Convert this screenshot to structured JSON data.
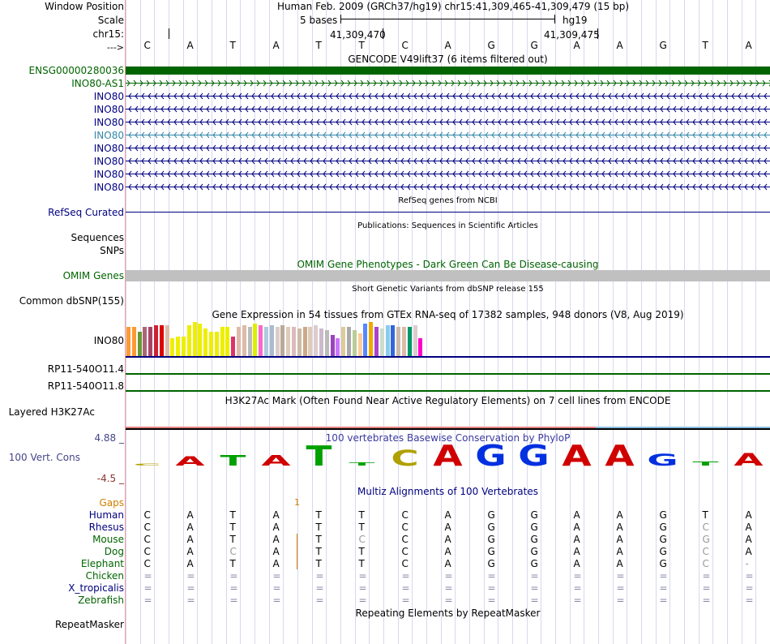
{
  "left_labels": {
    "window_position": "Window Position",
    "scale": "Scale",
    "chrom": "chr15:",
    "arrow": "--->",
    "gene_ensg": "ENSG00000280036",
    "gene_ino80as1": "INO80-AS1",
    "ino80_rows": [
      "INO80",
      "INO80",
      "INO80",
      "INO80",
      "INO80",
      "INO80",
      "INO80",
      "INO80"
    ],
    "refseq": "RefSeq Curated",
    "sequences": "Sequences",
    "snps": "SNPs",
    "omim": "OMIM Genes",
    "dbsnp": "Common dbSNP(155)",
    "gtex_gene": "INO80",
    "rp11_4": "RP11-540O11.4",
    "rp11_8": "RP11-540O11.8",
    "layered": "Layered H3K27Ac",
    "cons_max": "4.88 _",
    "cons_label": "100 Vert. Cons",
    "cons_min": "-4.5 _",
    "gaps": "Gaps",
    "species": [
      "Human",
      "Rhesus",
      "Mouse",
      "Dog",
      "Elephant",
      "Chicken",
      "X_tropicalis",
      "Zebrafish"
    ],
    "repeatmasker": "RepeatMasker"
  },
  "header": {
    "position": "Human Feb. 2009 (GRCh37/hg19)   chr15:41,309,465-41,309,479 (15 bp)",
    "scale_text": "5 bases",
    "assembly": "hg19",
    "coord1": "41,309,470",
    "coord2": "41,309,475"
  },
  "bases": [
    "C",
    "A",
    "T",
    "A",
    "T",
    "T",
    "C",
    "A",
    "G",
    "G",
    "A",
    "A",
    "G",
    "T",
    "A"
  ],
  "track_titles": {
    "gencode": "GENCODE V49lift37 (6 items filtered out)",
    "refseq": "RefSeq genes from NCBI",
    "publications": "Publications: Sequences in Scientific Articles",
    "omim": "OMIM Gene Phenotypes - Dark Green Can Be Disease-causing",
    "dbsnp": "Short Genetic Variants from dbSNP release 155",
    "gtex": "Gene Expression in 54 tissues from GTEx RNA-seq of 17382 samples, 948 donors (V8, Aug 2019)",
    "h3k27ac": "H3K27Ac Mark (Often Found Near Active Regulatory Elements) on 7 cell lines from ENCODE",
    "phylop": "100 vertebrates Basewise Conservation by PhyloP",
    "multiz": "Multiz Alignments of 100 Vertebrates",
    "repeat": "Repeating Elements by RepeatMasker"
  },
  "gaps_marker": "1",
  "alignment": {
    "Human": [
      "C",
      "A",
      "T",
      "A",
      "T",
      "T",
      "C",
      "A",
      "G",
      "G",
      "A",
      "A",
      "G",
      "T",
      "A"
    ],
    "Rhesus": [
      "C",
      "A",
      "T",
      "A",
      "T",
      "T",
      "C",
      "A",
      "G",
      "G",
      "A",
      "A",
      "G",
      "C",
      "A"
    ],
    "Mouse": [
      "C",
      "A",
      "T",
      "A",
      "T",
      "C",
      "C",
      "A",
      "G",
      "G",
      "A",
      "A",
      "G",
      "G",
      "A"
    ],
    "Dog": [
      "C",
      "A",
      "C",
      "A",
      "T",
      "T",
      "C",
      "A",
      "G",
      "G",
      "A",
      "A",
      "G",
      "C",
      "A"
    ],
    "Elephant": [
      "C",
      "A",
      "T",
      "A",
      "T",
      "T",
      "C",
      "A",
      "G",
      "G",
      "A",
      "A",
      "G",
      "C",
      "-"
    ],
    "Chicken": [
      "=",
      "=",
      "=",
      "=",
      "=",
      "=",
      "=",
      "=",
      "=",
      "=",
      "=",
      "=",
      "=",
      "=",
      "="
    ],
    "X_tropicalis": [
      "=",
      "=",
      "=",
      "=",
      "=",
      "=",
      "=",
      "=",
      "=",
      "=",
      "=",
      "=",
      "=",
      "=",
      "="
    ],
    "Zebrafish": [
      "=",
      "=",
      "=",
      "=",
      "=",
      "=",
      "=",
      "=",
      "=",
      "=",
      "=",
      "=",
      "=",
      "=",
      "="
    ]
  },
  "phylop_letters": [
    "C",
    "A",
    "T",
    "A",
    "T",
    "T",
    "C",
    "A",
    "G",
    "G",
    "A",
    "A",
    "G",
    "T",
    "A"
  ],
  "phylop_heights": [
    0.1,
    0.45,
    0.5,
    0.5,
    0.95,
    0.15,
    0.75,
    1.0,
    1.0,
    1.0,
    1.0,
    1.0,
    0.55,
    0.2,
    0.6
  ],
  "colors": {
    "A": "#d00000",
    "C": "#b0a000",
    "G": "#0030e0",
    "T": "#00a000",
    "gencode_green": "#006400",
    "ino80_blue": "#000080",
    "highlight_blue": "#3388aa"
  }
}
